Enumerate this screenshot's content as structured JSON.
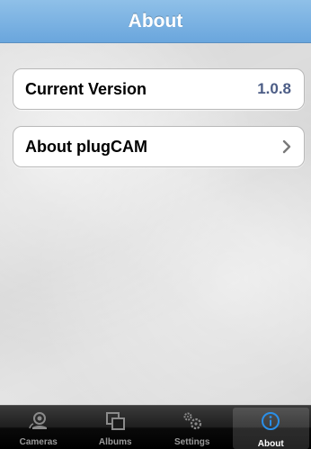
{
  "navbar": {
    "title": "About"
  },
  "rows": {
    "version": {
      "label": "Current Version",
      "value": "1.0.8"
    },
    "about": {
      "label": "About plugCAM",
      "chevron_icon": "chevron-right-icon"
    }
  },
  "tabbar": {
    "tabs": [
      {
        "label": "Cameras",
        "icon": "camera-icon",
        "selected": false
      },
      {
        "label": "Albums",
        "icon": "albums-icon",
        "selected": false
      },
      {
        "label": "Settings",
        "icon": "gears-icon",
        "selected": false
      },
      {
        "label": "About",
        "icon": "info-icon",
        "selected": true
      }
    ]
  },
  "colors": {
    "navbar": "#7ab3e3",
    "value_text": "#4c5d86",
    "selected_icon": "#2a8fe8"
  }
}
